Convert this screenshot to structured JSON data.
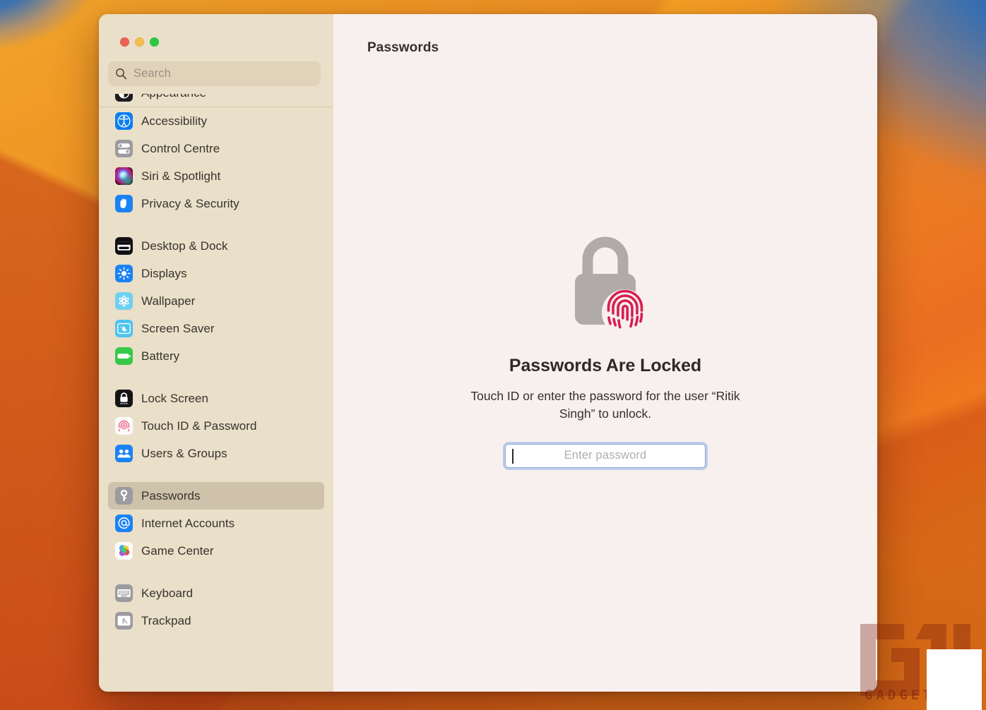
{
  "window": {
    "traffic_lights": [
      {
        "name": "close",
        "label": "Close",
        "color": "#ef5f56"
      },
      {
        "name": "minimize",
        "label": "Minimize",
        "color": "#f5bd4f"
      },
      {
        "name": "maximize",
        "label": "Maximize",
        "color": "#2dc93f"
      }
    ]
  },
  "search": {
    "placeholder": "Search",
    "value": "",
    "icon": "search-icon"
  },
  "sidebar": {
    "clipped_top_item": {
      "label": "Appearance",
      "icon": "appearance-icon"
    },
    "groups": [
      {
        "items": [
          {
            "label": "Accessibility",
            "icon": "accessibility-icon",
            "selected": false
          },
          {
            "label": "Control Centre",
            "icon": "control-centre-icon",
            "selected": false
          },
          {
            "label": "Siri & Spotlight",
            "icon": "siri-icon",
            "selected": false
          },
          {
            "label": "Privacy & Security",
            "icon": "privacy-icon",
            "selected": false
          }
        ]
      },
      {
        "items": [
          {
            "label": "Desktop & Dock",
            "icon": "desktop-dock-icon",
            "selected": false
          },
          {
            "label": "Displays",
            "icon": "displays-icon",
            "selected": false
          },
          {
            "label": "Wallpaper",
            "icon": "wallpaper-icon",
            "selected": false
          },
          {
            "label": "Screen Saver",
            "icon": "screensaver-icon",
            "selected": false
          },
          {
            "label": "Battery",
            "icon": "battery-icon",
            "selected": false
          }
        ]
      },
      {
        "items": [
          {
            "label": "Lock Screen",
            "icon": "lock-screen-icon",
            "selected": false
          },
          {
            "label": "Touch ID & Password",
            "icon": "touch-id-icon",
            "selected": false
          },
          {
            "label": "Users & Groups",
            "icon": "users-groups-icon",
            "selected": false
          }
        ]
      },
      {
        "items": [
          {
            "label": "Passwords",
            "icon": "key-icon",
            "selected": true
          },
          {
            "label": "Internet Accounts",
            "icon": "internet-accounts-icon",
            "selected": false
          },
          {
            "label": "Game Center",
            "icon": "game-center-icon",
            "selected": false
          }
        ]
      },
      {
        "items": [
          {
            "label": "Keyboard",
            "icon": "keyboard-icon",
            "selected": false
          },
          {
            "label": "Trackpad",
            "icon": "trackpad-icon",
            "selected": false
          }
        ]
      }
    ]
  },
  "main": {
    "title": "Passwords",
    "locked": {
      "icon": "lock-with-fingerprint-icon",
      "heading": "Passwords Are Locked",
      "subtext": "Touch ID or enter the password for the user “Ritik Singh” to unlock.",
      "password_field": {
        "placeholder": "Enter password",
        "value": "",
        "focused": true
      }
    }
  },
  "watermark": {
    "text": "GADGETS"
  },
  "colors": {
    "sidebar_bg": "#eadfc8",
    "main_bg": "#f7f0ee",
    "selected_row": "#a08b68",
    "lock_gray": "#b0aaa8",
    "fingerprint_red": "#d81e50",
    "focus_ring_blue": "#668ed9"
  }
}
